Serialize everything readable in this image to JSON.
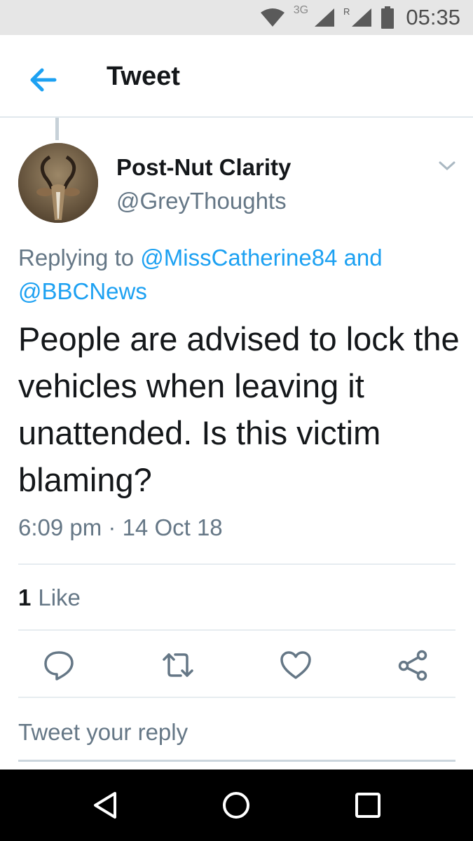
{
  "status_bar": {
    "network": "3G",
    "roaming": "R",
    "time": "05:35",
    "icons": [
      "wifi-icon",
      "signal-icon",
      "roaming-signal-icon",
      "battery-icon"
    ]
  },
  "header": {
    "title": "Tweet",
    "back_icon": "arrow-left-icon"
  },
  "tweet": {
    "author_name": "Post-Nut Clarity",
    "author_handle": "@GreyThoughts",
    "reply_prefix": "Replying to",
    "reply_mention_1": "@MissCatherine84",
    "reply_and": "and",
    "reply_mention_2": "@BBCNews",
    "text": "People are advised to lock the vehicles when leaving it unattended. Is this victim blaming?",
    "timestamp": "6:09 pm · 14 Oct 18",
    "like_count": "1",
    "like_label": "Like"
  },
  "actions": [
    "reply-icon",
    "retweet-icon",
    "like-icon",
    "share-icon"
  ],
  "composer": {
    "placeholder": "Tweet your reply"
  },
  "navigation": [
    "back-triangle-icon",
    "home-circle-icon",
    "recents-square-icon"
  ],
  "colors": {
    "accent": "#1da1f2",
    "secondary_text": "#657786",
    "primary_text": "#14171a",
    "status_bar": "#e6e6e6",
    "nav_bar": "#000000"
  }
}
